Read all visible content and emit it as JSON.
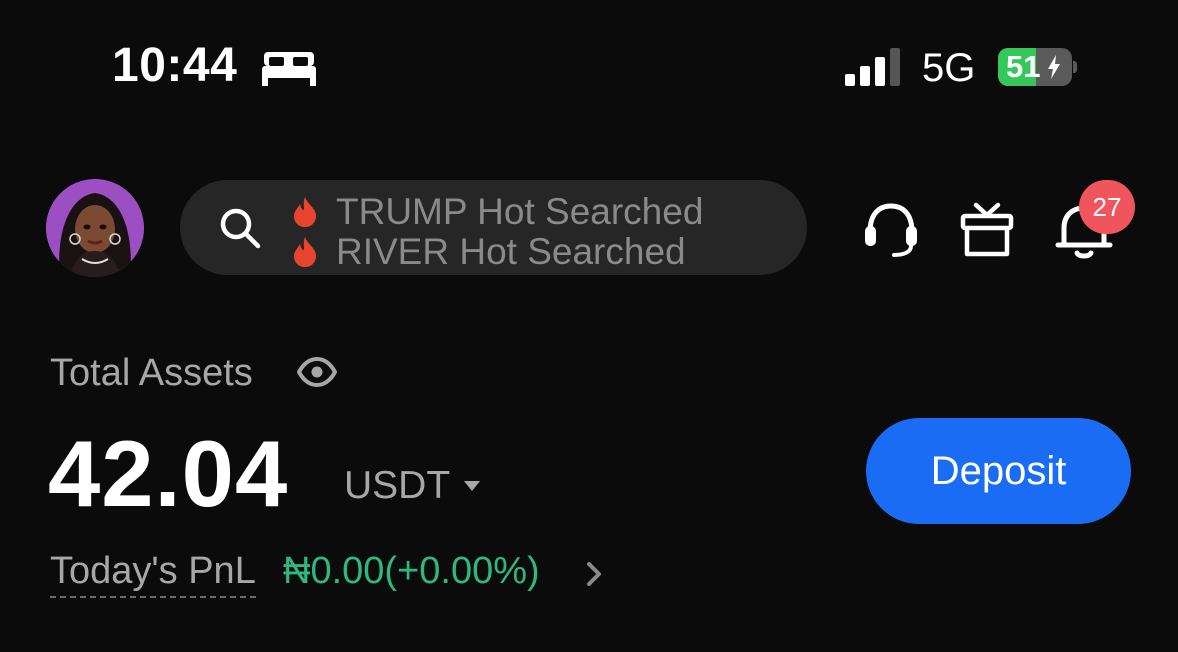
{
  "status_bar": {
    "time": "10:44",
    "network": "5G",
    "battery_percent": "51",
    "battery_level": 0.51,
    "icons": [
      "bed-icon",
      "cellular-signal-icon",
      "battery-charging-icon"
    ]
  },
  "header": {
    "avatar": "user-avatar",
    "search_ticker": [
      "TRUMP Hot Searched",
      "RIVER Hot Searched"
    ],
    "icons": [
      "search-icon",
      "fire-icon",
      "support-headset-icon",
      "gift-icon",
      "bell-icon"
    ],
    "notification_count": "27"
  },
  "assets": {
    "label": "Total Assets",
    "balance": "42.04",
    "currency": "USDT",
    "deposit_label": "Deposit",
    "pnl_label": "Today's PnL",
    "pnl_value": "₦0.00(+0.00%)"
  },
  "colors": {
    "background": "#0b0b0b",
    "accent_blue": "#1b6cf5",
    "pnl_green": "#2eb77e",
    "badge_red": "#f0555e",
    "battery_green": "#34c759",
    "fire_red": "#e8442e"
  }
}
